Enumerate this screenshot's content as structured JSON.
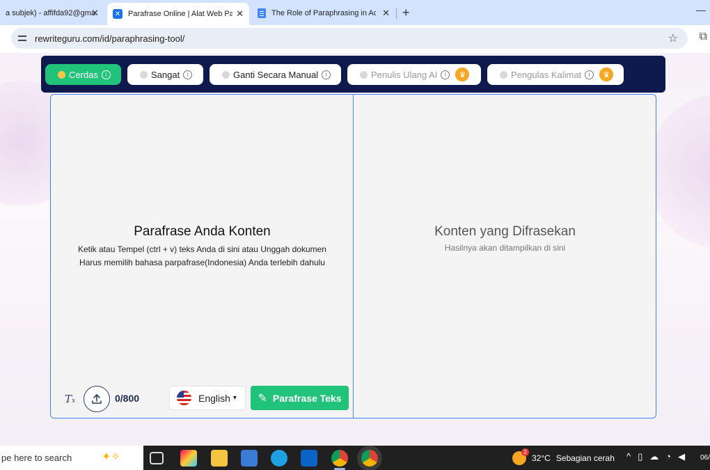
{
  "browser": {
    "tabs": [
      {
        "title": "a subjek) - affifda92@gma",
        "active": false
      },
      {
        "title": "Parafrase Online | Alat Web Para",
        "active": true
      },
      {
        "title": "The Role of Paraphrasing in Aca",
        "active": false
      }
    ],
    "url": "rewriteguru.com/id/paraphrasing-tool/"
  },
  "modes": [
    {
      "label": "Cerdas",
      "active": true,
      "premium": false
    },
    {
      "label": "Sangat",
      "active": false,
      "premium": false
    },
    {
      "label": "Ganti Secara Manual",
      "active": false,
      "premium": false
    },
    {
      "label": "Penulis Ulang AI",
      "active": false,
      "premium": true
    },
    {
      "label": "Pengulas Kalimat",
      "active": false,
      "premium": true
    }
  ],
  "input_pane": {
    "title": "Parafrase Anda Konten",
    "hint_line1": "Ketik atau Tempel (ctrl + v) teks Anda di sini atau Unggah dokumen",
    "hint_line2": "Harus memilih bahasa parpafrase(Indonesia) Anda terlebih dahulu",
    "counter": "0/800",
    "language": "English",
    "submit_label": "Parafrase Teks"
  },
  "output_pane": {
    "title": "Konten yang Difrasekan",
    "hint": "Hasilnya akan ditampilkan di sini"
  },
  "taskbar": {
    "search_placeholder": "pe here to search",
    "weather_temp": "32°C",
    "weather_desc": "Sebagian cerah",
    "clock": "06/"
  }
}
